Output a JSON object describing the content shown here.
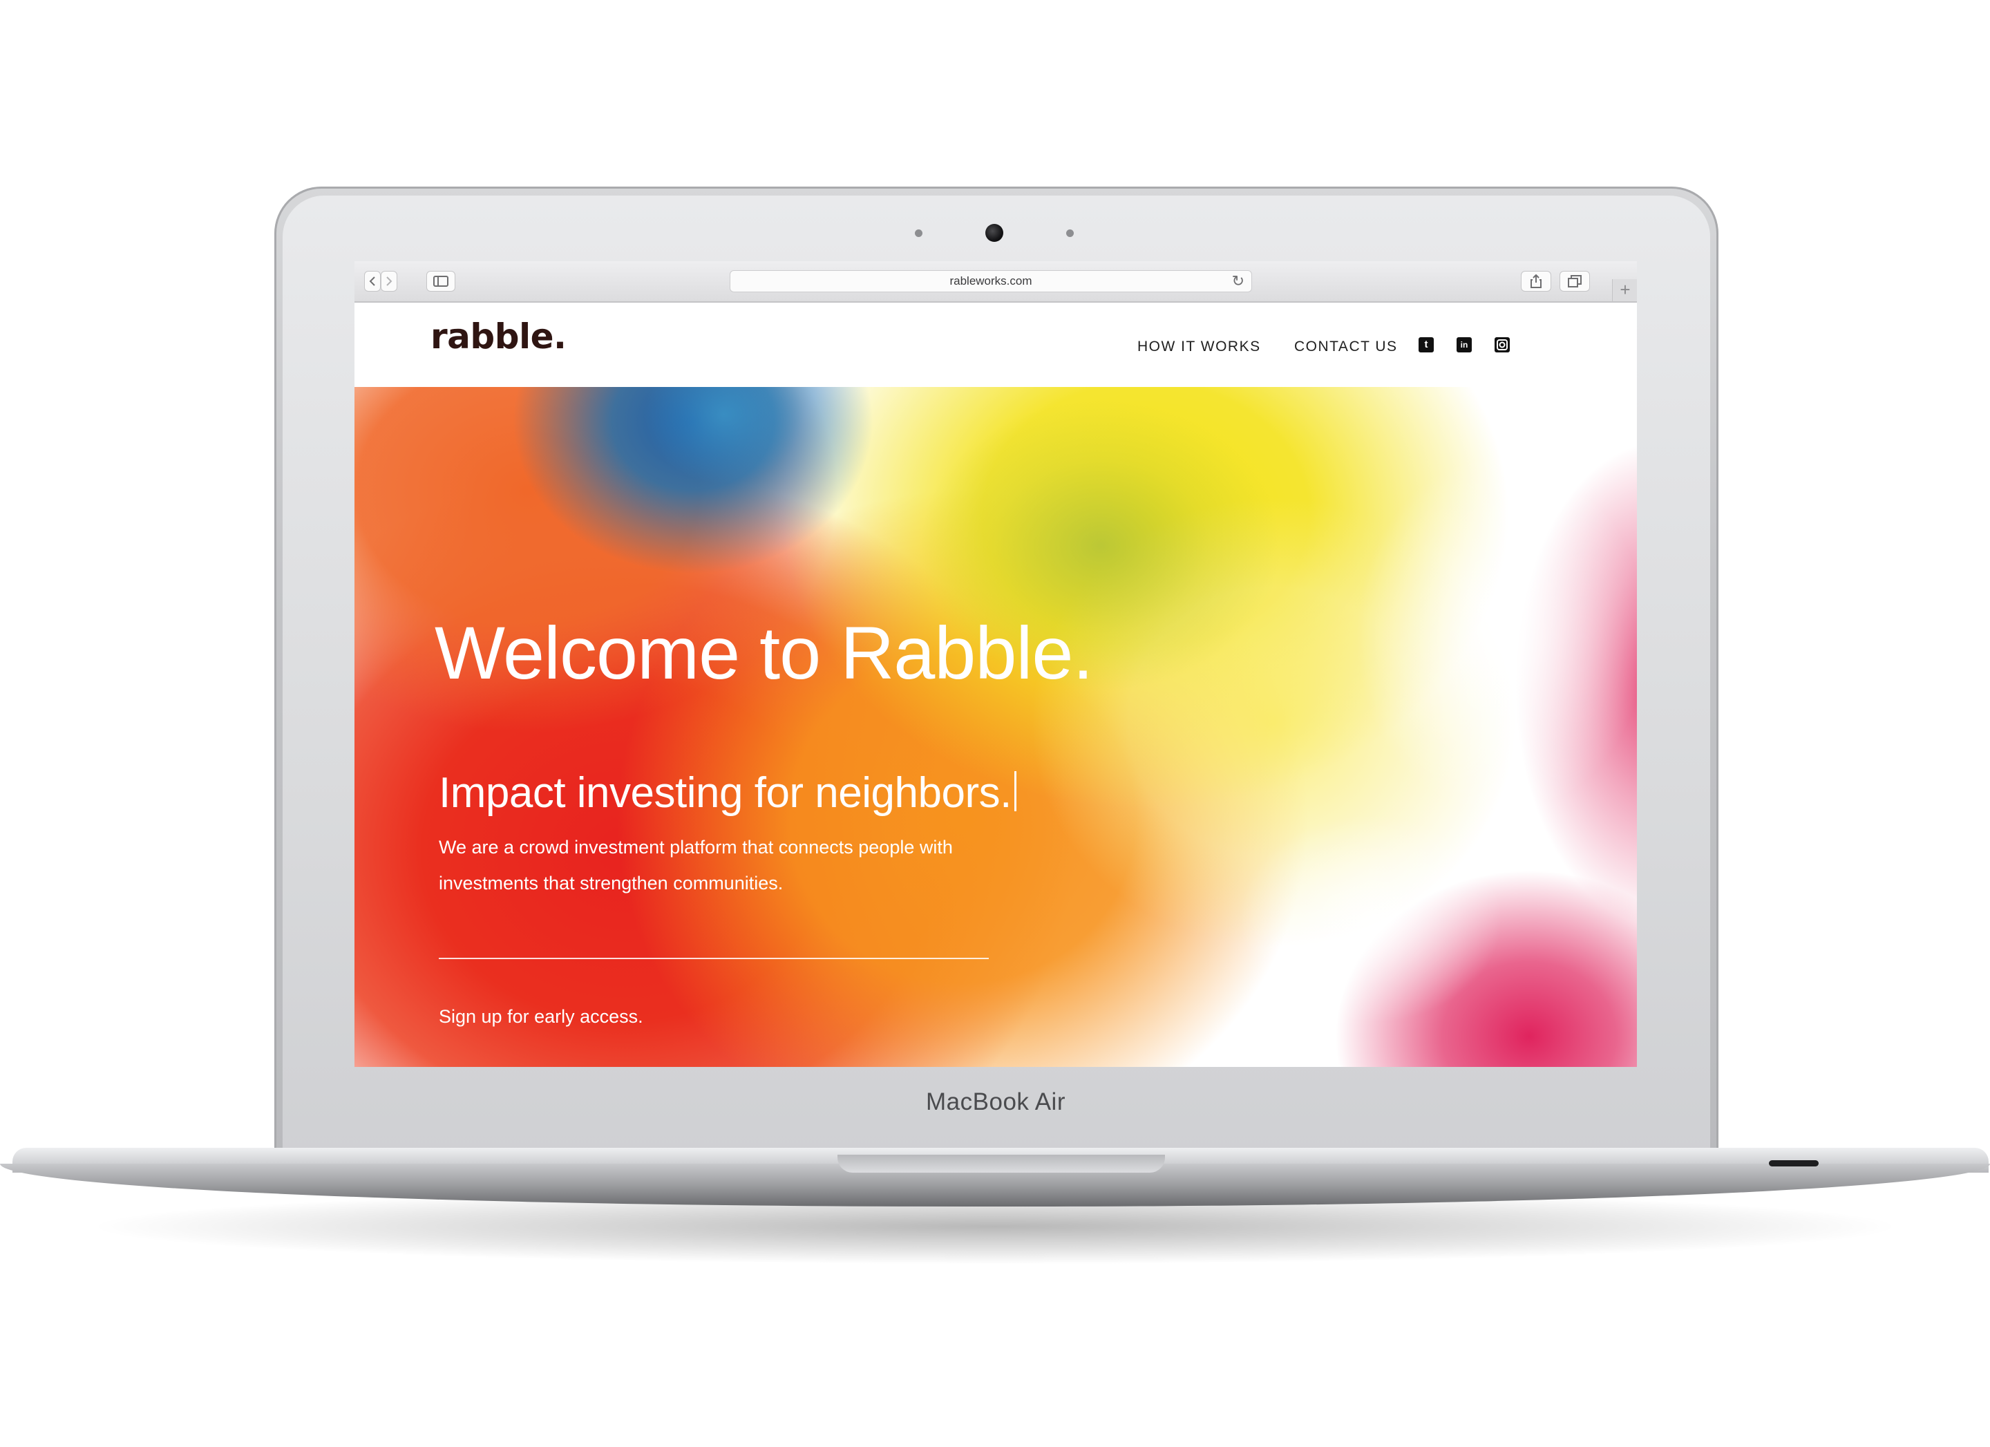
{
  "device": {
    "brand_label": "MacBook Air"
  },
  "browser": {
    "url": "rableworks.com"
  },
  "site": {
    "logo": "rabble.",
    "nav": {
      "how_it_works": "HOW IT WORKS",
      "contact_us": "CONTACT US"
    },
    "social_icons": [
      "twitter-icon",
      "linkedin-icon",
      "instagram-icon"
    ],
    "hero": {
      "title": "Welcome to Rabble.",
      "subtitle": "Impact investing for neighbors.",
      "description": "We are a crowd investment platform that connects people with investments that strengthen communities.",
      "cta": "Sign up for early access."
    }
  },
  "colors": {
    "logo": "#2f1512",
    "hero_text": "#ffffff",
    "paint_red": "#e8231f",
    "paint_orange": "#f5821f",
    "paint_yellow": "#f4e21a",
    "paint_blue": "#1f6fae",
    "paint_pink": "#e0245e"
  }
}
